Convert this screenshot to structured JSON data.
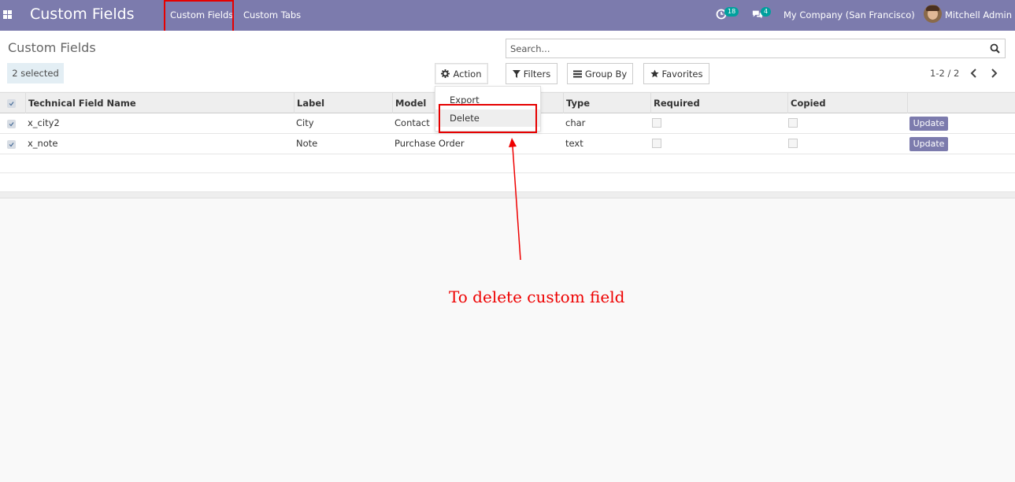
{
  "navbar": {
    "app_title": "Custom Fields",
    "menu": [
      "Custom Fields",
      "Custom Tabs"
    ],
    "activity_count": "18",
    "message_count": "4",
    "company": "My Company (San Francisco)",
    "user": "Mitchell Admin"
  },
  "control_panel": {
    "breadcrumb": "Custom Fields",
    "selected_label": "2 selected",
    "action_label": "Action",
    "search_placeholder": "Search...",
    "filters_label": "Filters",
    "group_by_label": "Group By",
    "favorites_label": "Favorites",
    "pager": "1-2 / 2"
  },
  "action_menu": {
    "items": [
      "Export",
      "Delete"
    ],
    "highlighted": "Delete"
  },
  "table": {
    "columns": [
      "Technical Field Name",
      "Label",
      "Model",
      "Type",
      "Required",
      "Copied"
    ],
    "rows": [
      {
        "technical_name": "x_city2",
        "label": "City",
        "model": "Contact",
        "type": "char",
        "required": false,
        "copied": false,
        "selected": true,
        "button": "Update"
      },
      {
        "technical_name": "x_note",
        "label": "Note",
        "model": "Purchase Order",
        "type": "text",
        "required": false,
        "copied": false,
        "selected": true,
        "button": "Update"
      }
    ]
  },
  "annotation": {
    "text": "To delete custom field",
    "color": "#e00000"
  },
  "colors": {
    "navbar": "#7c7bad",
    "accent": "#7c7bad",
    "badge": "#00a09d",
    "annotation": "#e00000"
  }
}
